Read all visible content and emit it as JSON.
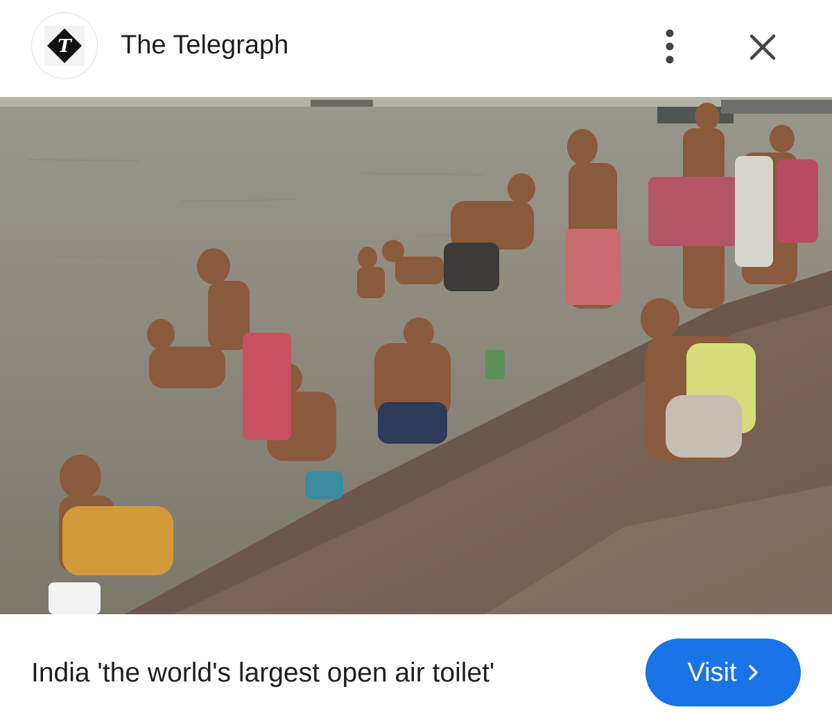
{
  "header": {
    "source_name": "The Telegraph",
    "logo_icon": "telegraph-t-logo-icon",
    "more_icon": "more-vert-icon",
    "close_icon": "close-icon"
  },
  "image": {
    "alt": "People bathing and washing at a river bank",
    "lens_icon": "google-lens-icon"
  },
  "footer": {
    "caption": "India 'the world's largest open air toilet'",
    "visit_label": "Visit",
    "visit_icon": "chevron-right-icon"
  },
  "colors": {
    "accent": "#1a73e8",
    "text": "#1f1f1f"
  }
}
